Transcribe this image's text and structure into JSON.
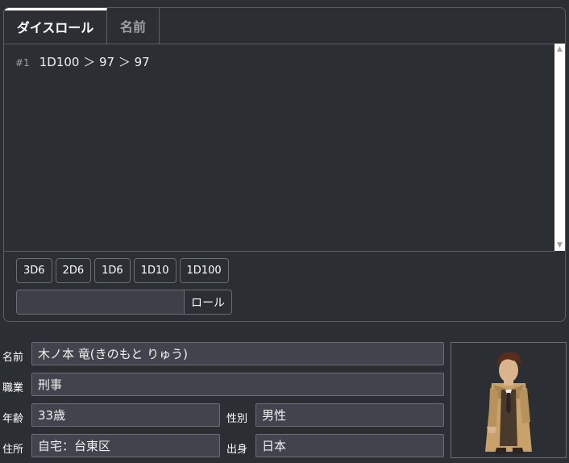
{
  "tabs": {
    "dice_roll": "ダイスロール",
    "name": "名前"
  },
  "log": {
    "entries": [
      {
        "num": "#1",
        "text": "1D100 ＞ 97 ＞ 97"
      }
    ]
  },
  "dice_buttons": [
    "3D6",
    "2D6",
    "1D6",
    "1D10",
    "1D100"
  ],
  "roll": {
    "input_value": "",
    "button_label": "ロール"
  },
  "profile": {
    "name_label": "名前",
    "name_value": "木ノ本 竜(きのもと りゅう)",
    "job_label": "職業",
    "job_value": "刑事",
    "age_label": "年齢",
    "age_value": "33歳",
    "gender_label": "性別",
    "gender_value": "男性",
    "address_label": "住所",
    "address_value": "自宅：台東区",
    "origin_label": "出身",
    "origin_value": "日本"
  },
  "colors": {
    "background": "#2b2e33",
    "field": "#41444c",
    "border": "#6a6e76"
  },
  "icons": {
    "scroll_up": "triangle-up-icon",
    "scroll_down": "triangle-down-icon"
  }
}
